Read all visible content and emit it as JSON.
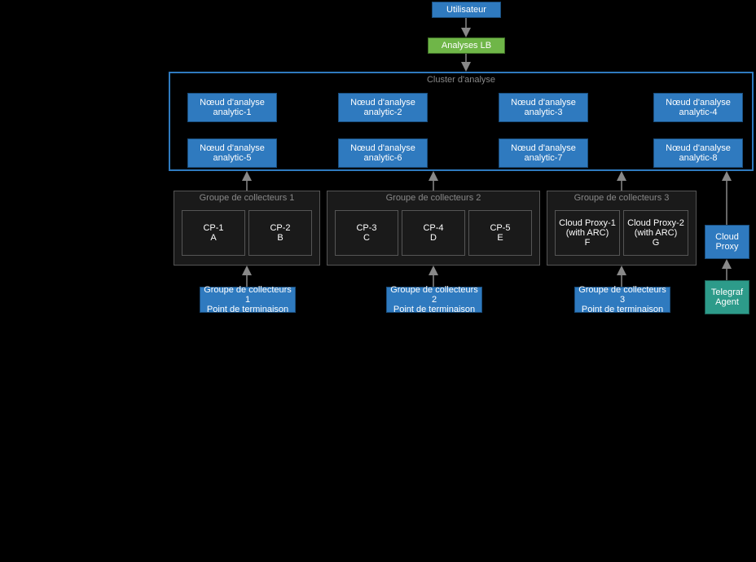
{
  "user": "Utilisateur",
  "lb": "Analyses LB",
  "cluster_label": "Cluster d'analyse",
  "nodes": {
    "r1": [
      {
        "l1": "Nœud d'analyse",
        "l2": "analytic-1"
      },
      {
        "l1": "Nœud d'analyse",
        "l2": "analytic-2"
      },
      {
        "l1": "Nœud d'analyse",
        "l2": "analytic-3"
      },
      {
        "l1": "Nœud d'analyse",
        "l2": "analytic-4"
      }
    ],
    "r2": [
      {
        "l1": "Nœud d'analyse",
        "l2": "analytic-5"
      },
      {
        "l1": "Nœud d'analyse",
        "l2": "analytic-6"
      },
      {
        "l1": "Nœud d'analyse",
        "l2": "analytic-7"
      },
      {
        "l1": "Nœud d'analyse",
        "l2": "analytic-8"
      }
    ]
  },
  "groups": [
    {
      "label": "Groupe de collecteurs 1",
      "items": [
        {
          "l1": "CP-1",
          "l2": "A"
        },
        {
          "l1": "CP-2",
          "l2": "B"
        }
      ]
    },
    {
      "label": "Groupe de collecteurs 2",
      "items": [
        {
          "l1": "CP-3",
          "l2": "C"
        },
        {
          "l1": "CP-4",
          "l2": "D"
        },
        {
          "l1": "CP-5",
          "l2": "E"
        }
      ]
    },
    {
      "label": "Groupe de collecteurs 3",
      "items": [
        {
          "l1": "Cloud Proxy-1",
          "l2": "(with ARC)",
          "l3": "F"
        },
        {
          "l1": "Cloud Proxy-2",
          "l2": "(with ARC)",
          "l3": "G"
        }
      ]
    }
  ],
  "endpoints": [
    {
      "l1": "Groupe de collecteurs 1",
      "l2": "Point de terminaison"
    },
    {
      "l1": "Groupe de collecteurs 2",
      "l2": "Point de terminaison"
    },
    {
      "l1": "Groupe de collecteurs 3",
      "l2": "Point de terminaison"
    }
  ],
  "cloud_proxy": {
    "l1": "Cloud",
    "l2": "Proxy"
  },
  "telegraf": {
    "l1": "Telegraf",
    "l2": "Agent"
  }
}
